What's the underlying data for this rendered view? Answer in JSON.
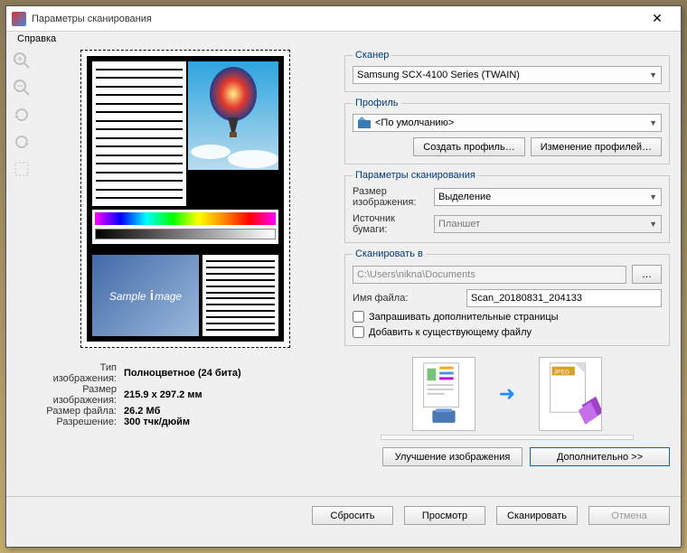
{
  "window": {
    "title": "Параметры сканирования"
  },
  "menu": {
    "help": "Справка"
  },
  "sample_text": "Sample image",
  "info": {
    "type_label": "Тип изображения:",
    "type_value": "Полноцветное (24 бита)",
    "size_label": "Размер изображения:",
    "size_value": "215.9 x 297.2 мм",
    "filesize_label": "Размер файла:",
    "filesize_value": "26.2 Мб",
    "res_label": "Разрешение:",
    "res_value": "300 тчк/дюйм"
  },
  "scanner": {
    "legend": "Сканер",
    "value": "Samsung SCX-4100 Series (TWAIN)"
  },
  "profile": {
    "legend": "Профиль",
    "value": "<По умолчанию>",
    "create": "Создать профиль…",
    "edit": "Изменение профилей…"
  },
  "params": {
    "legend": "Параметры сканирования",
    "imgsize_label": "Размер изображения:",
    "imgsize_value": "Выделение",
    "source_label": "Источник бумаги:",
    "source_value": "Планшет"
  },
  "scan_to": {
    "legend": "Сканировать в",
    "path": "C:\\Users\\nikna\\Documents",
    "browse": "…",
    "fname_label": "Имя файла:",
    "fname_value": "Scan_20180831_204133",
    "ask_more": "Запрашивать дополнительные страницы",
    "append": "Добавить к существующему файлу"
  },
  "workflow": {
    "jpeg": "JPEG"
  },
  "bottom": {
    "enhance": "Улучшение изображения",
    "advanced": "Дополнительно >>"
  },
  "footer": {
    "reset": "Сбросить",
    "preview": "Просмотр",
    "scan": "Сканировать",
    "cancel": "Отмена"
  }
}
